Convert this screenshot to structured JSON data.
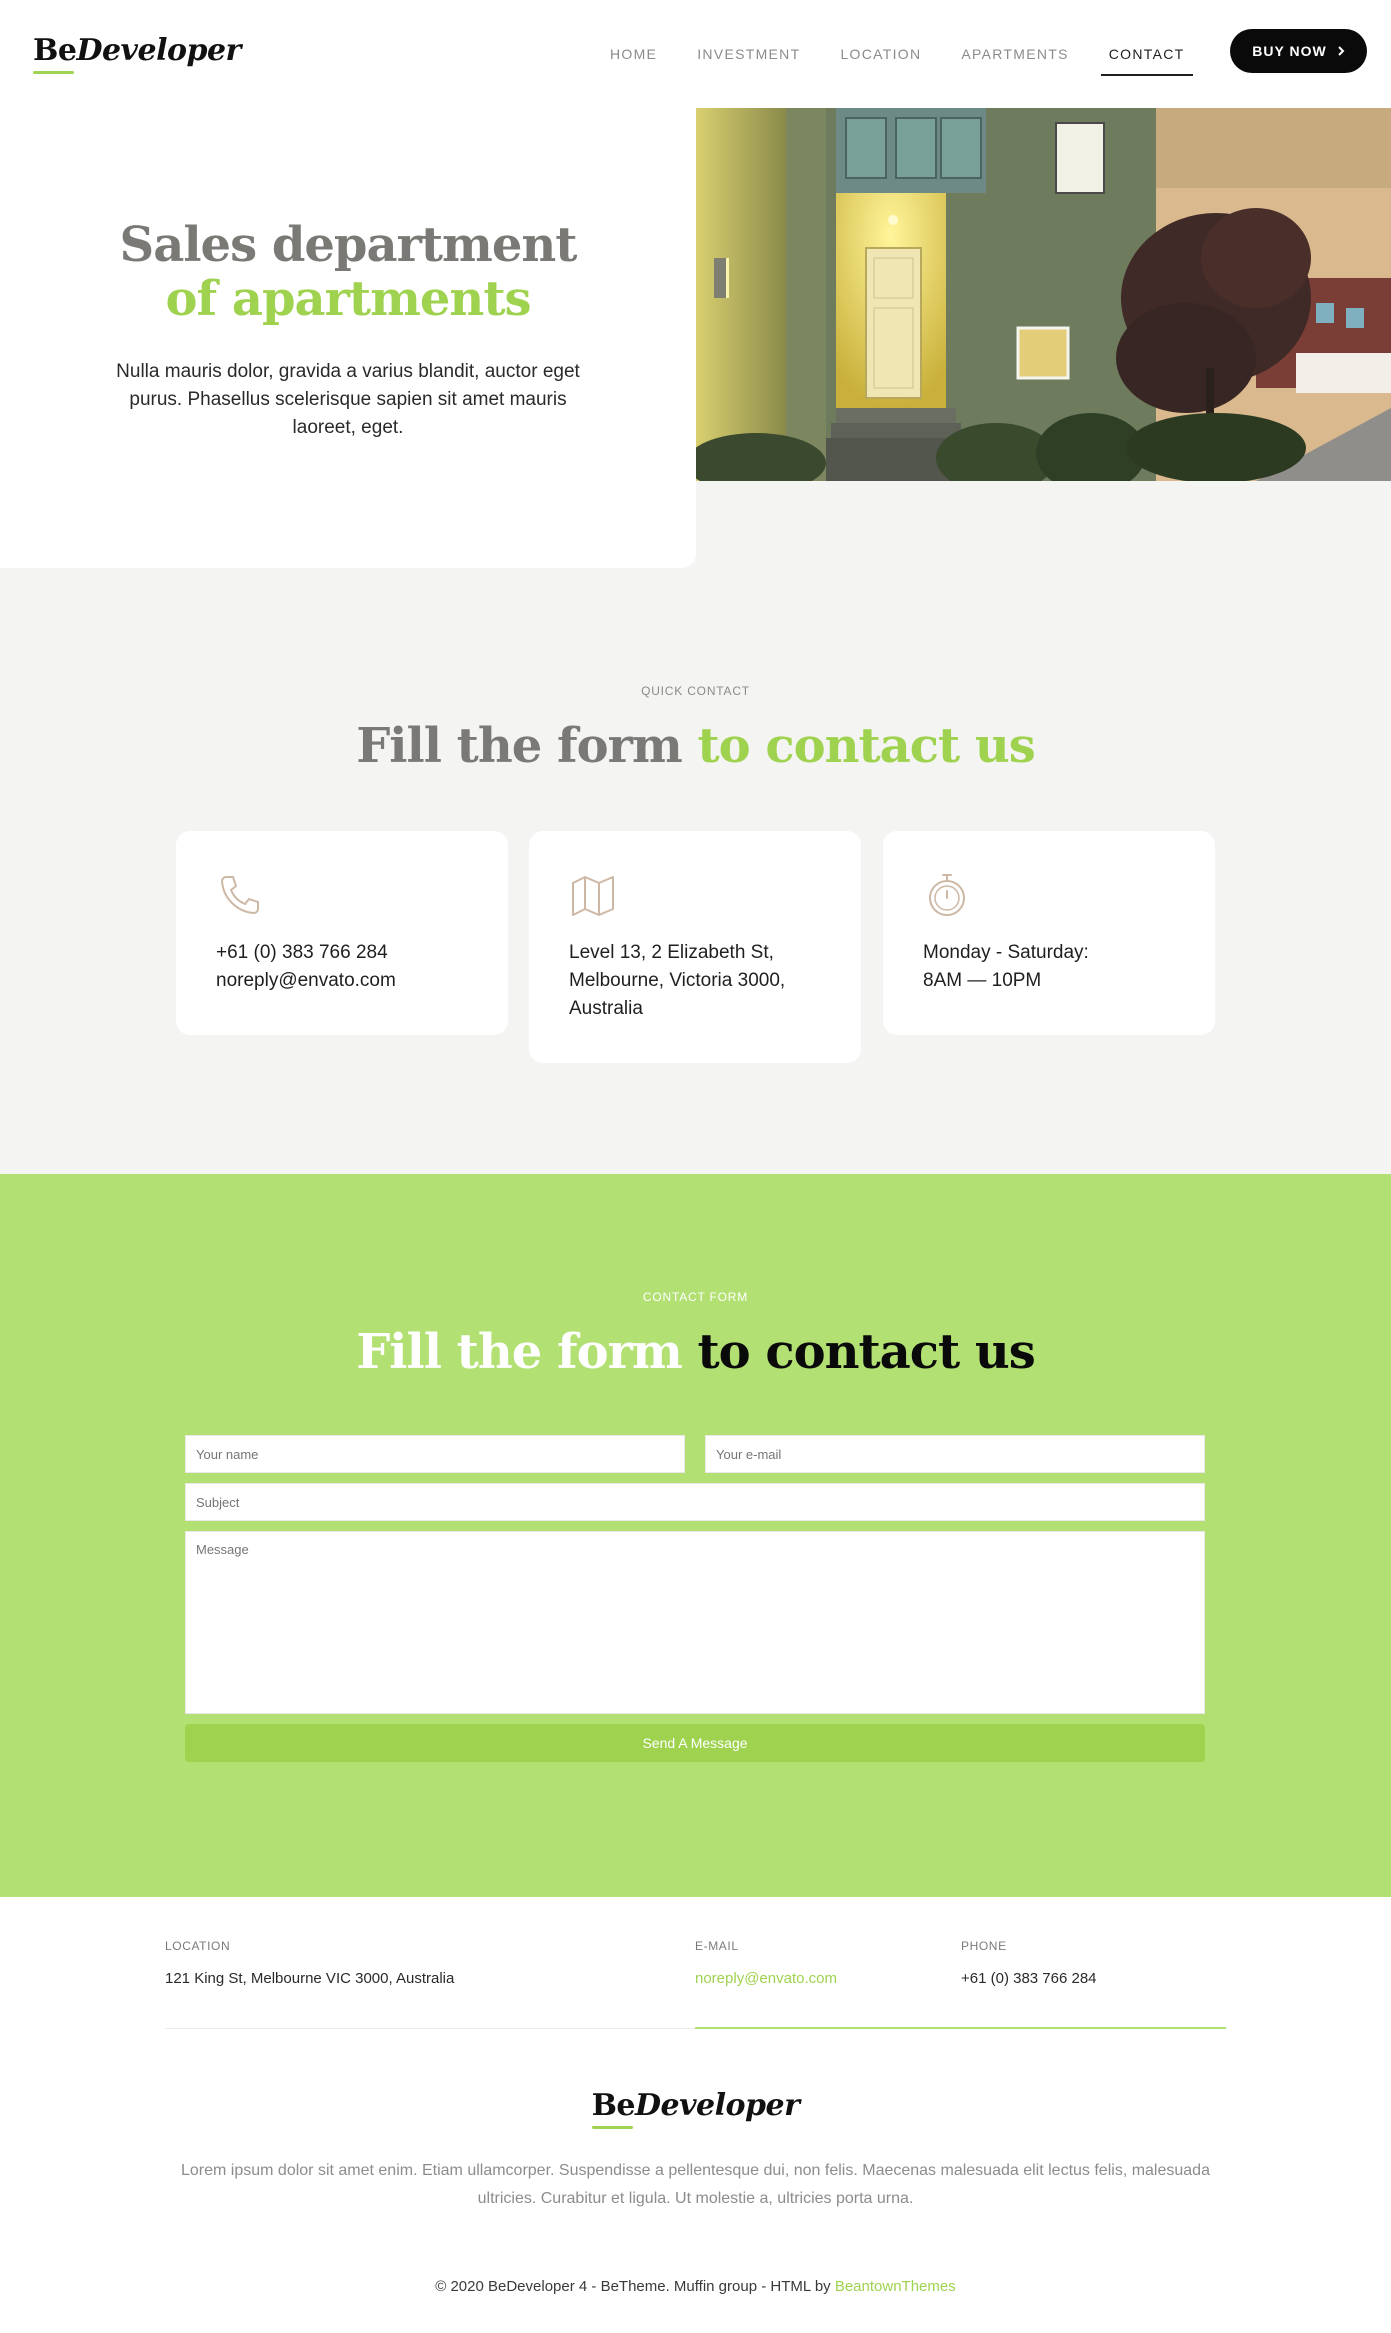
{
  "header": {
    "logo_be": "Be",
    "logo_dev": "Developer",
    "nav": [
      "HOME",
      "INVESTMENT",
      "LOCATION",
      "APARTMENTS",
      "CONTACT"
    ],
    "active_nav": "CONTACT",
    "buy_label": "BUY NOW",
    "buy_icon": "chevron-right-icon"
  },
  "hero": {
    "title_line1": "Sales department",
    "title_line2": "of apartments",
    "text": "Nulla mauris dolor, gravida a varius blandit, auctor eget purus. Phasellus scelerisque sapien sit amet mauris laoreet, eget."
  },
  "quick_contact": {
    "kicker": "QUICK CONTACT",
    "title_a": "Fill the form",
    "title_b": "to contact us",
    "cards": [
      {
        "icon": "phone-icon",
        "lines": [
          "+61 (0) 383 766 284",
          "noreply@envato.com"
        ]
      },
      {
        "icon": "map-icon",
        "lines": [
          "Level 13, 2 Elizabeth St,",
          "Melbourne, Victoria 3000,",
          "Australia"
        ]
      },
      {
        "icon": "stopwatch-icon",
        "lines": [
          "Monday - Saturday:",
          "8AM — 10PM"
        ]
      }
    ]
  },
  "contact_form": {
    "kicker": "CONTACT FORM",
    "title_a": "Fill the form",
    "title_b": "to contact us",
    "name_placeholder": "Your name",
    "email_placeholder": "Your e-mail",
    "subject_placeholder": "Subject",
    "message_placeholder": "Message",
    "submit_label": "Send A Message"
  },
  "footer": {
    "location_label": "LOCATION",
    "location_value": "121 King St, Melbourne VIC 3000, Australia",
    "email_label": "E-MAIL",
    "email_value": "noreply@envato.com",
    "phone_label": "PHONE",
    "phone_value": "+61 (0) 383 766 284",
    "logo_be": "Be",
    "logo_dev": "Developer",
    "about": "Lorem ipsum dolor sit amet enim. Etiam ullamcorper. Suspendisse a pellentesque dui, non felis. Maecenas malesuada elit lectus felis, malesuada ultricies. Curabitur et ligula. Ut molestie a, ultricies porta urna.",
    "copyright_text": "© 2020 BeDeveloper 4 - BeTheme. Muffin group - HTML by",
    "copyright_link": "BeantownThemes"
  },
  "colors": {
    "accent_green": "#9fd24f",
    "section_green": "#b2e072",
    "title_gray": "#7a7975",
    "light_bg": "#f4f4f2"
  }
}
